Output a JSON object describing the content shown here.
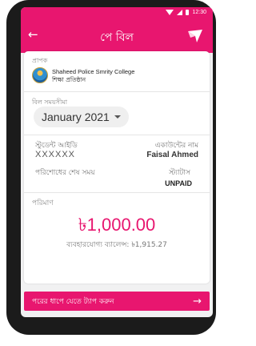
{
  "status_bar": {
    "time": "12:30"
  },
  "header": {
    "title": "পে বিল"
  },
  "provider": {
    "label": "প্রাপক",
    "name": "Shaheed Police Smrity College",
    "type": "শিক্ষা প্রতিষ্ঠান"
  },
  "bill_period": {
    "label": "বিল সময়সীমা",
    "value": "January 2021"
  },
  "student": {
    "id_label": "স্টুডেন্ট আইডি",
    "id_value": "XXXXXX"
  },
  "account": {
    "name_label": "একাউন্টের নাম",
    "name_value": "Faisal Ahmed"
  },
  "payment": {
    "due_label": "পরিশোধের শেষ সময়",
    "status_label": "স্ট্যাটাস",
    "status_value": "UNPAID"
  },
  "amount": {
    "label": "পরিমাণ",
    "value": "৳1,000.00",
    "balance": "ব্যবহারযোগ্য ব্যালেন্স: ৳1,915.27"
  },
  "action": {
    "next_label": "পরের ধাপে যেতে ট্যাপ করুন",
    "arrow": "→"
  },
  "colors": {
    "accent": "#e8166f",
    "background": "#f1f1f2",
    "device": "#1b1b1b"
  },
  "icons": [
    "back-arrow-icon",
    "bkash-logo-icon",
    "college-logo-icon",
    "chevron-down-icon",
    "arrow-right-icon"
  ]
}
